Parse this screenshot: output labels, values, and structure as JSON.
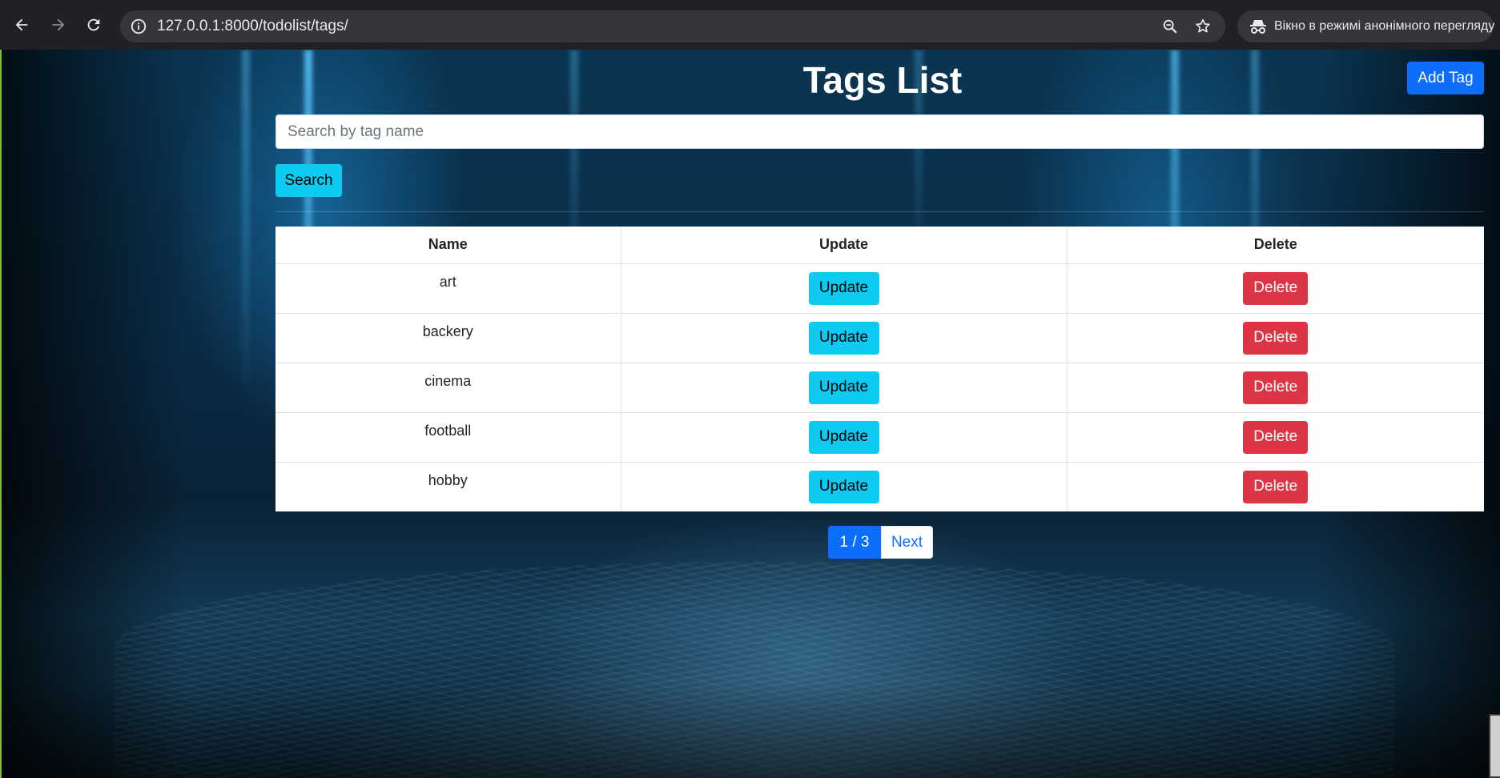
{
  "browser": {
    "url": "127.0.0.1:8000/todolist/tags/",
    "incognito_label": "Вікно в режимі анонімного перегляду"
  },
  "page": {
    "title": "Tags List",
    "add_button": "Add Tag",
    "search": {
      "placeholder": "Search by tag name",
      "value": "",
      "button": "Search"
    },
    "table": {
      "headers": [
        "Name",
        "Update",
        "Delete"
      ],
      "rows": [
        {
          "name": "art",
          "update": "Update",
          "delete": "Delete"
        },
        {
          "name": "backery",
          "update": "Update",
          "delete": "Delete"
        },
        {
          "name": "cinema",
          "update": "Update",
          "delete": "Delete"
        },
        {
          "name": "football",
          "update": "Update",
          "delete": "Delete"
        },
        {
          "name": "hobby",
          "update": "Update",
          "delete": "Delete"
        }
      ]
    },
    "pagination": {
      "current": "1 / 3",
      "next": "Next"
    }
  },
  "colors": {
    "primary": "#0d6efd",
    "info": "#0dcaf0",
    "danger": "#dc3545"
  }
}
